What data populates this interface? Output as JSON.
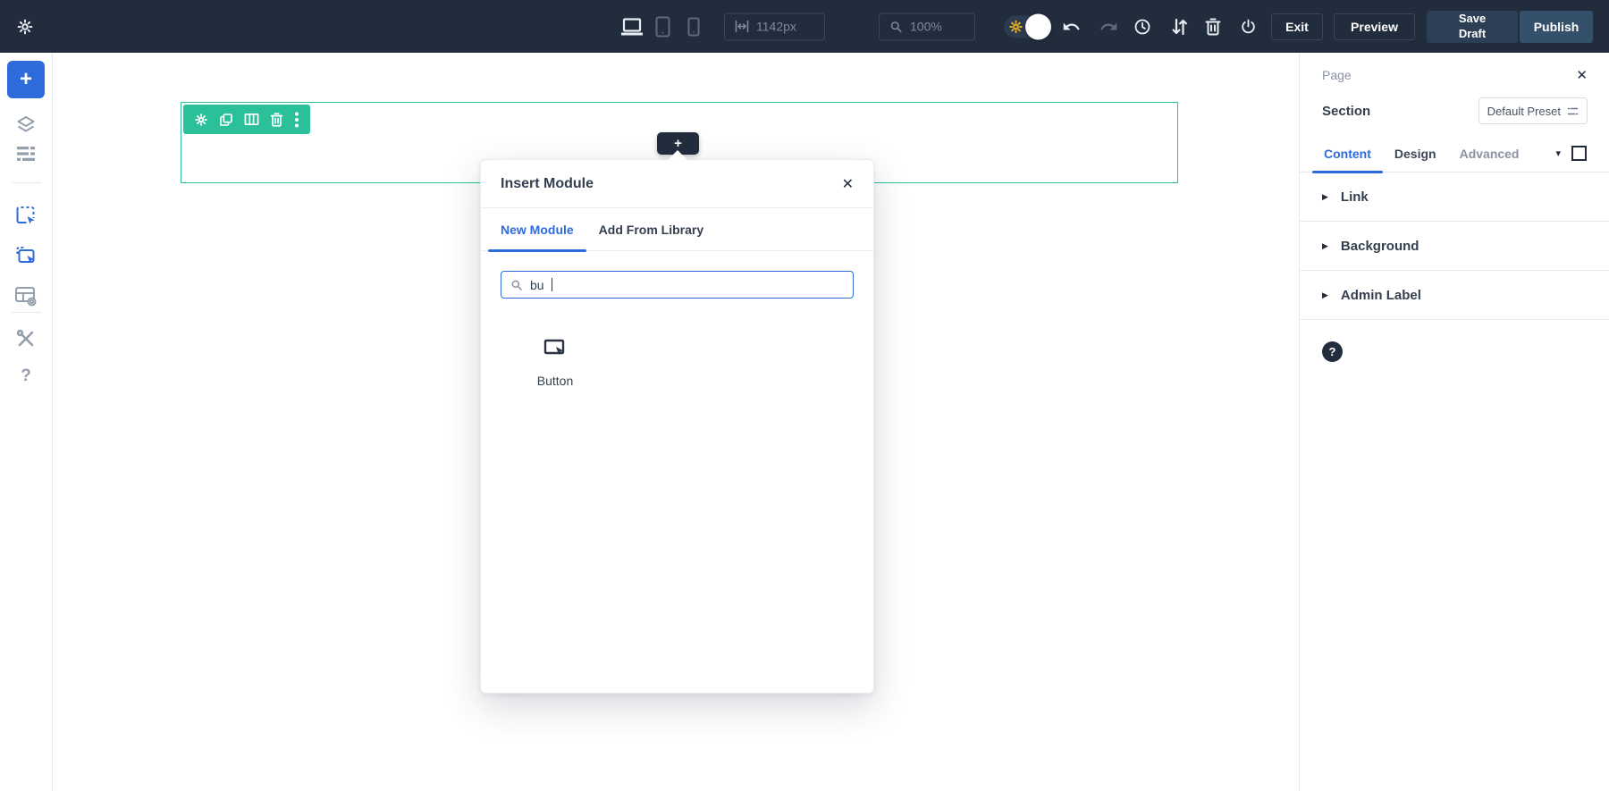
{
  "glyphs": {
    "plus": "+",
    "close": "✕",
    "question": "?",
    "caret_down": "▾",
    "caret_right": "▶"
  },
  "colors": {
    "topbar_bg": "#212c3d",
    "accent_blue": "#2e6bdb",
    "section_teal": "#2ac09a",
    "toggle_gear_yellow": "#e6af25",
    "save_draft_bg": "#2c3f55",
    "publish_bg": "#35506a"
  },
  "topbar": {
    "left_icons": [
      "settings-gear"
    ],
    "responsive_modes": [
      {
        "name": "desktop",
        "active": true
      },
      {
        "name": "tablet",
        "active": false
      },
      {
        "name": "phone",
        "active": false
      }
    ],
    "width_field": {
      "value": "1142px",
      "icon": "width-arrows"
    },
    "zoom_field": {
      "value": "100%",
      "icon": "magnifier"
    },
    "builder_toggle": {
      "state": "on",
      "icon": "gear"
    },
    "action_icons": [
      "undo",
      "redo",
      "history-clock",
      "sort-arrows",
      "trash",
      "power"
    ],
    "buttons": {
      "exit": "Exit",
      "preview": "Preview",
      "save_draft": "Save Draft",
      "publish": "Publish"
    }
  },
  "left_sidebar": {
    "icons": [
      "add-plus",
      "layers",
      "wireframe-list",
      "click-select",
      "click-select-alt",
      "grid-settings",
      "tools",
      "help"
    ]
  },
  "canvas": {
    "section_toolbar_icons": [
      "settings-gear",
      "duplicate",
      "columns",
      "trash",
      "menu-dots"
    ],
    "add_module_icon": "plus"
  },
  "modal": {
    "title": "Insert Module",
    "tabs": [
      {
        "label": "New Module",
        "active": true
      },
      {
        "label": "Add From Library",
        "active": false
      }
    ],
    "search": {
      "value": "bu",
      "icon": "magnifier"
    },
    "results": [
      {
        "label": "Button",
        "icon": "button-cursor"
      }
    ]
  },
  "right_panel": {
    "title": "Page",
    "element_row": {
      "label": "Section",
      "preset_button": "Default Preset"
    },
    "tabs": [
      {
        "label": "Content",
        "active": true
      },
      {
        "label": "Design",
        "active": false
      },
      {
        "label": "Advanced",
        "active": false
      }
    ],
    "sections": [
      {
        "label": "Link"
      },
      {
        "label": "Background"
      },
      {
        "label": "Admin Label"
      }
    ]
  }
}
